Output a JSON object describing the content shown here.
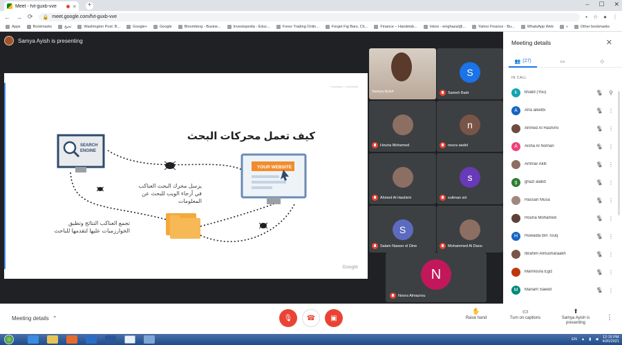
{
  "browser": {
    "tab_title": "Meet - fvt-guxb-vve",
    "url": "meet.google.com/fvt-guxb-vve",
    "bookmarks": [
      "Apps",
      "Bookmarks",
      "تحيح",
      "Washington Post: B...",
      "Google+",
      "Google",
      "Bloomberg - Busine...",
      "Investopedia - Educ...",
      "Forex Trading Onlin...",
      "Forget Fig Bars, Ch...",
      "Finance – Handelsb...",
      "Inbox - einghazal@...",
      "Yahoo Finance - Bu...",
      "WhatsApp Web",
      "»",
      "Other bookmarks"
    ]
  },
  "presentation": {
    "presenter_label": "Samya Ayish is presenting",
    "slide_title": "كيف تعمل محركات البحث",
    "search_engine_label": "SEARCH ENGINE",
    "website_label": "YOUR WEBSITE",
    "crawler_text": "يرسل محرك البحث العناكب في أرجاء الويب للبحث عن المعلومات",
    "results_text": "تجمع العناكب النتائج وتطبق الخوارزميات عليها لتقدمها للباحث",
    "watermark": "Google",
    "tiny_text": "Proprietary + Confidential"
  },
  "tiles": [
    {
      "name": "Samya Ayish",
      "type": "video"
    },
    {
      "name": "Sameh Badr",
      "initial": "S",
      "color": "#1a73e8"
    },
    {
      "name": "Houria Mohamed",
      "type": "photo"
    },
    {
      "name": "noura aadel",
      "initial": "n",
      "color": "#795548"
    },
    {
      "name": "Ahmed Al Hashimi",
      "type": "photo"
    },
    {
      "name": "suliman siri",
      "initial": "s",
      "color": "#673ab7"
    },
    {
      "name": "Salam Nasser el Dine",
      "initial": "S",
      "color": "#5c6bc0"
    },
    {
      "name": "Mohammed Al Daou",
      "type": "photo"
    },
    {
      "name": "Noora Almazrou",
      "initial": "N",
      "color": "#c2185b"
    }
  ],
  "panel": {
    "title": "Meeting details",
    "people_count": "(27)",
    "section_label": "IN CALL",
    "participants": [
      {
        "name": "khalid (You)",
        "initial": "k",
        "color": "#12a4af"
      },
      {
        "name": "Afra alketbi",
        "initial": "A",
        "color": "#1565c0"
      },
      {
        "name": "Ahmed Al Hashimi",
        "initial": "",
        "color": "#6d4c41"
      },
      {
        "name": "Aisha Al Noman",
        "initial": "A",
        "color": "#ec407a"
      },
      {
        "name": "Ammar Aklli",
        "initial": "",
        "color": "#8d6e63"
      },
      {
        "name": "ghazl alabd",
        "initial": "g",
        "color": "#2e7d32"
      },
      {
        "name": "Hassan Musa",
        "initial": "",
        "color": "#a1887f"
      },
      {
        "name": "Houria Mohamed",
        "initial": "",
        "color": "#5d4037"
      },
      {
        "name": "Huwaida Bin Touq",
        "initial": "H",
        "color": "#1565c0"
      },
      {
        "name": "Ibrahim Almusharaakh",
        "initial": "",
        "color": "#795548"
      },
      {
        "name": "Mannoura Egiz",
        "initial": "",
        "color": "#bf360c"
      },
      {
        "name": "Mariam Saeed",
        "initial": "M",
        "color": "#00897b"
      }
    ]
  },
  "bottom": {
    "meeting_details": "Meeting details",
    "raise_hand": "Raise hand",
    "captions": "Turn on captions",
    "presenting": "Samya Ayish is presenting"
  },
  "taskbar": {
    "lang": "EN",
    "time": "12:15 PM",
    "date": "4/20/2021"
  }
}
